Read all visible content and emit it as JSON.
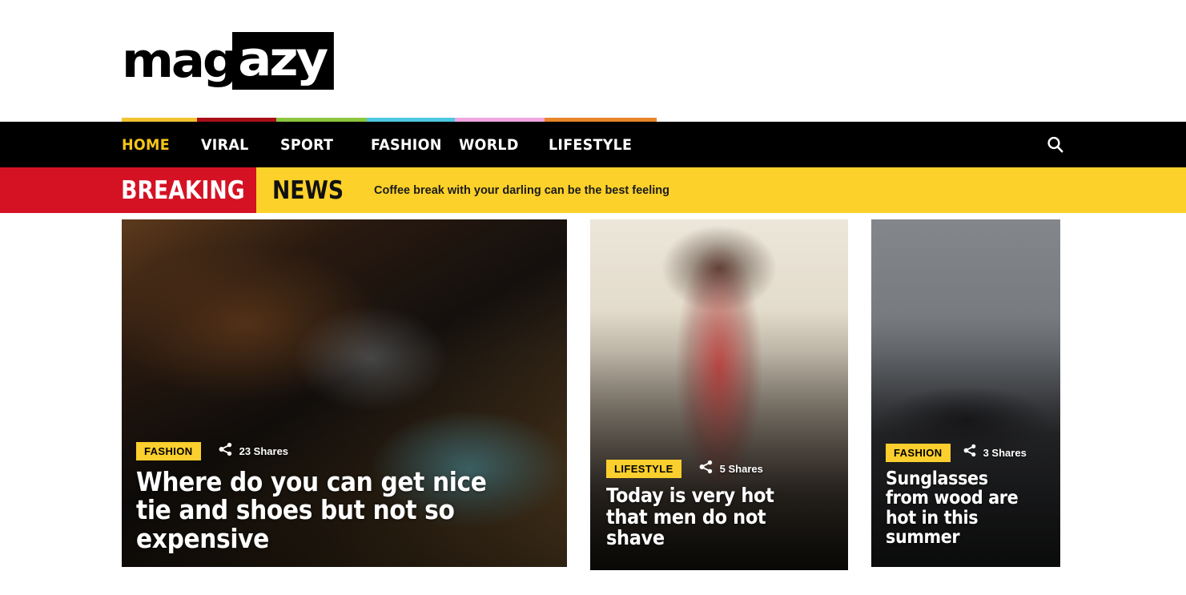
{
  "brand": {
    "logo_part_1": "mag",
    "logo_part_2": "azy"
  },
  "nav": {
    "items": [
      {
        "label": "HOME",
        "active": true,
        "strip_color": "#f2c230"
      },
      {
        "label": "VIRAL",
        "active": false,
        "strip_color": "#aa0f18"
      },
      {
        "label": "SPORT",
        "active": false,
        "strip_color": "#8cc63f"
      },
      {
        "label": "FASHION",
        "active": false,
        "strip_color": "#4dc8e0"
      },
      {
        "label": "WORLD",
        "active": false,
        "strip_color": "#f0a6e0"
      },
      {
        "label": "LIFESTYLE",
        "active": false,
        "strip_color": "#e8862a"
      }
    ],
    "search_icon": "search-icon",
    "active_color": "#f5c518",
    "bar_color": "#000000"
  },
  "breaking": {
    "label": "BREAKING",
    "news_word": "NEWS",
    "headline": "Coffee break with your darling can be the best feeling",
    "red_color": "#d51224",
    "yellow_color": "#fcd12a"
  },
  "cards": [
    {
      "category": "FASHION",
      "share_icon": "share-icon",
      "shares": "23 Shares",
      "title": "Where do you can get nice tie and shoes but not so expensive",
      "badge_color": "#fbcf2d"
    },
    {
      "category": "LIFESTYLE",
      "share_icon": "share-icon",
      "shares": "5 Shares",
      "title": "Today is very hot that men do not shave",
      "badge_color": "#fbcf2d"
    },
    {
      "category": "FASHION",
      "share_icon": "share-icon",
      "shares": "3 Shares",
      "title": "Sunglasses from wood are hot in this summer",
      "badge_color": "#fbcf2d"
    }
  ]
}
